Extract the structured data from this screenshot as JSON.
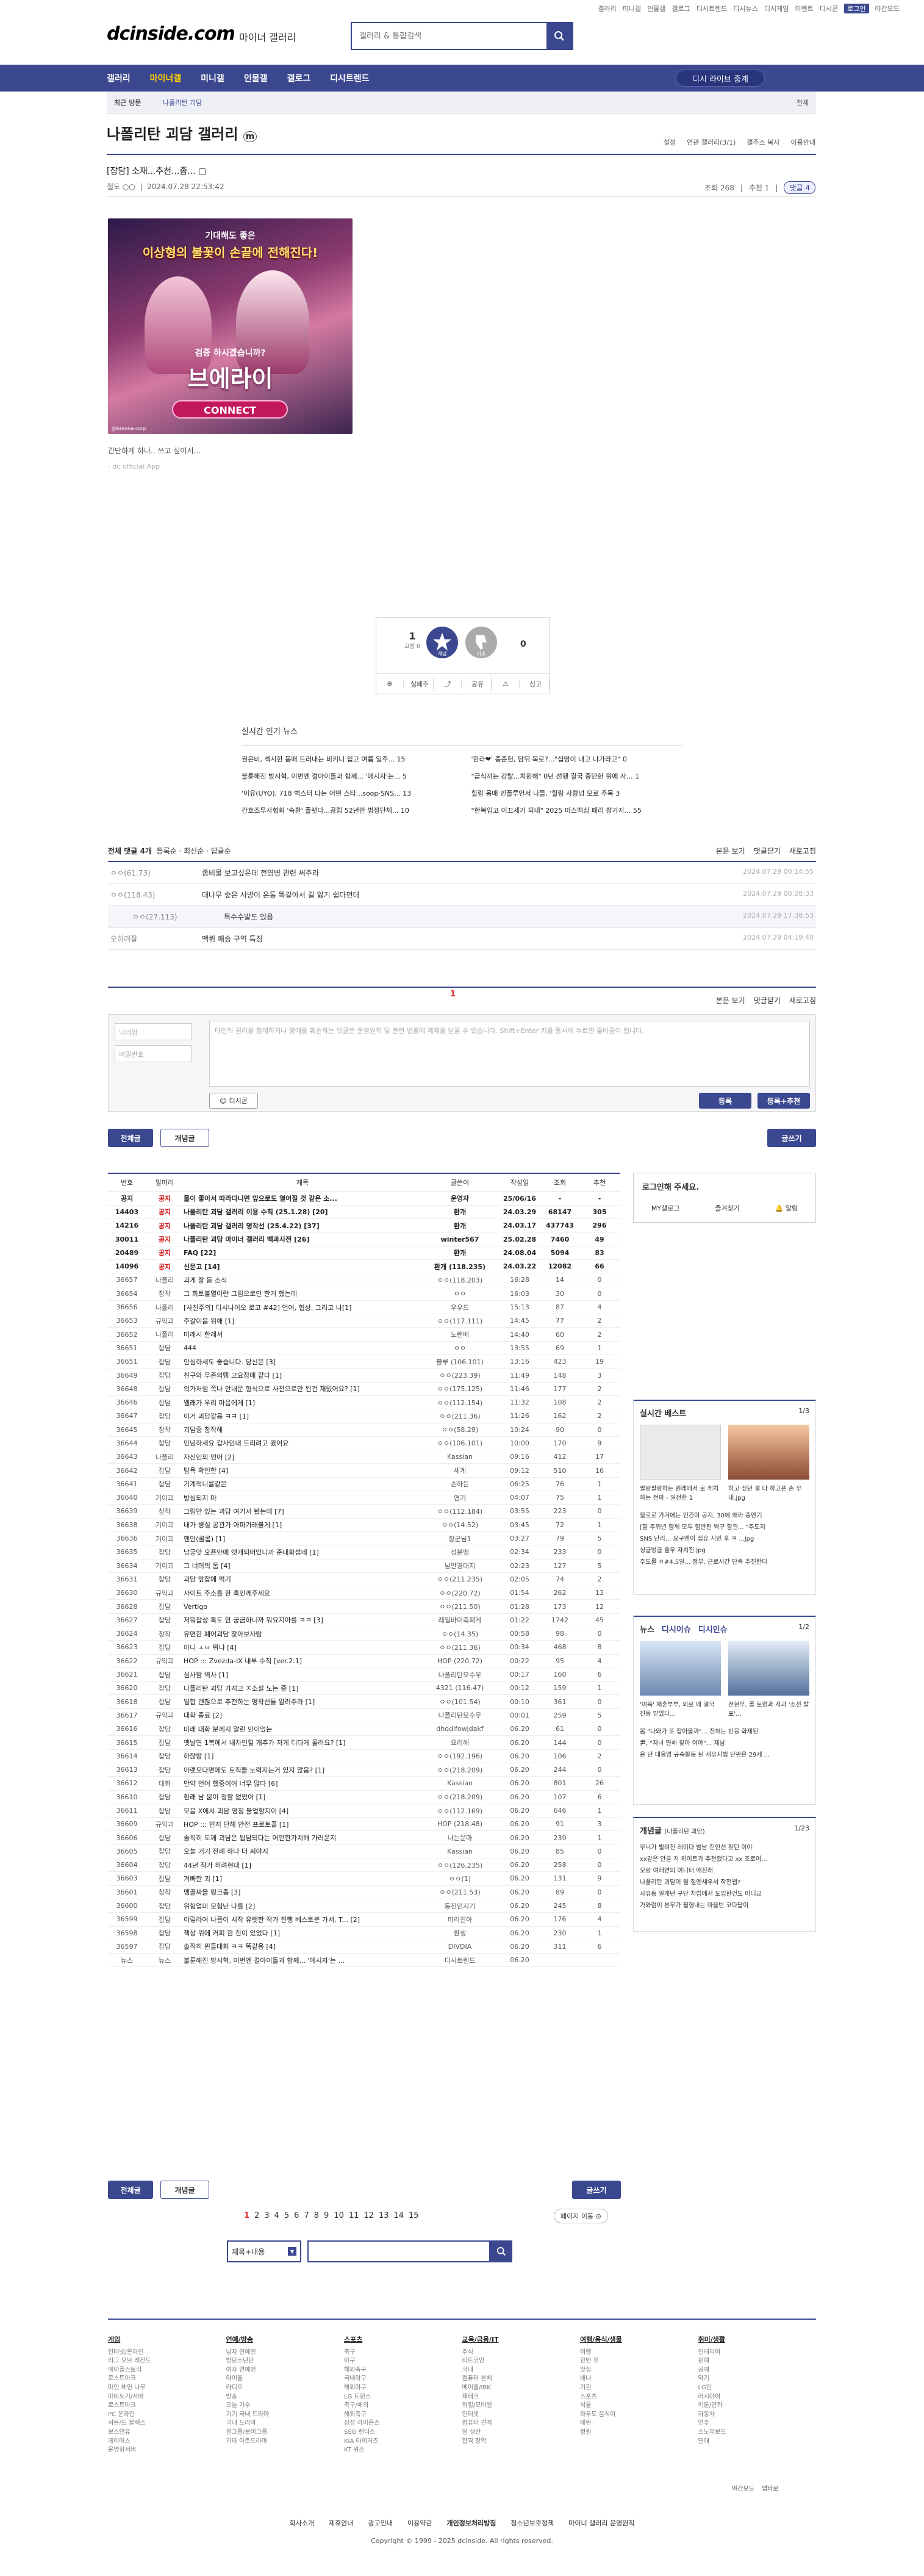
{
  "top_links": [
    "갤러리",
    "미니갤",
    "인물갤",
    "갤로그",
    "디시트렌드",
    "디시뉴스",
    "디시게임",
    "이벤트",
    "디시콘",
    "로그인",
    "야간모드"
  ],
  "logo": "dcinside.com",
  "logo_sub": "마이너 갤러리",
  "search": {
    "placeholder": "갤러리 & 통합검색"
  },
  "nav": [
    "갤러리",
    "마이너갤",
    "미니갤",
    "인물갤",
    "갤로그",
    "디시트렌드"
  ],
  "nav_button": "디시 라이브 중계",
  "sub": {
    "recent": "최근 방문",
    "tag": "나폴리탄 괴담",
    "all": "전체"
  },
  "gallery_title": "나폴리탄 괴담 갤러리",
  "gallery_tools": [
    "설정",
    "연관 갤러리(3/1)",
    "갤주소 복사",
    "이용안내"
  ],
  "post": {
    "title": "[잡담] 소재...추천...좀... ▢",
    "author": "철도 ○○",
    "date": "2024.07.28 22:53:42",
    "views": "조회 268",
    "rec": "추천 1",
    "comments": "댓글 4"
  },
  "poster": {
    "l1": "기대해도 좋은",
    "l2": "이상형의 불꽃이 손끝에 전해진다!",
    "l3": "검증 하시겠습니까?",
    "l4": "브에라이",
    "l5": "CONNECT",
    "l6": "@brenna-corp"
  },
  "body_text": "간단하게 하나.. 쓰고 싶어서...",
  "source": "- dc official App",
  "vote": {
    "up": "1",
    "up_sub": "고정 0",
    "up_label": "개념",
    "down": "0",
    "down_label": "비추",
    "share": "실베추",
    "copy": "공유",
    "report": "신고"
  },
  "hot": {
    "title": "실시간 인기 뉴스",
    "items": [
      "권은비, 섹시한 몸매 드러내는 비키니 입고 여름 일주... 15",
      "'한라❤' 종준헌, 담뒤 목로?...\"십명이 내고 나가라고\" 0",
      "불륜해진 방시혁, 이번엔 걸아이돌과 함께... '애시자'는... 5",
      "\"급식끼는 강탈...치원해\" 0년 선행 결국 중단한 위에 사... 1",
      "'이유(UYO), 718 벅스터 다는 어떤 스타...soop·SNS... 13",
      "힐링 몸매 인플루언서 나들, '힐링 사랑넘 모로 주목 3",
      "간호조무사협회 '속환' 플랫다...공립 52년만 법정단체... 10",
      "\"한복입고 이끄세기 되내\" 2025 미스맥심 패리 참가자... 55"
    ]
  },
  "comments": {
    "all": "전체 댓글 4개",
    "sort1": "등록순",
    "sort2": "최신순",
    "sort3": "답글순",
    "view": "본문 보기",
    "fold": "댓글닫기",
    "refresh": "새로고침",
    "rows": [
      {
        "n": "ㅇㅇ(61.73)",
        "t": "좀비물 보고싶은데 전염병 관련 써주라",
        "d": "2024.07.29 00:14:55"
      },
      {
        "n": "ㅇㅇ(118.43)",
        "t": "대나무 숲은 사방이 온통 똑같아서 길 잃기 쉽다던데",
        "d": "2024.07.29 00:28:33"
      },
      {
        "n": "ㅇㅇ(27.113)",
        "t": "독수수발도 있음",
        "d": "2024.07.29 17:38:53"
      },
      {
        "n": "오히려잘",
        "t": "맥퀴 패송 구역 특징",
        "d": "2024.07.29 04:19:40"
      }
    ]
  },
  "comment_page": "1",
  "write": {
    "nick": "닉네임",
    "pw": "비밀번호",
    "guide": "타인의 권리를 침해하거나 명예를 훼손하는 댓글은 운영원칙 및 관련 법률에 제재를 받을 수 있습니다. Shift+Enter 키를 동시에 누르면 줄바꿈이 됩니다.",
    "dccon": "디시콘",
    "submit": "등록",
    "submit_rec": "등록+추천"
  },
  "buttons": {
    "all": "전체글",
    "concept": "개념글",
    "write": "글쓰기"
  },
  "table": {
    "headers": [
      "번호",
      "말머리",
      "제목",
      "글쓴이",
      "작성일",
      "조회",
      "추천"
    ],
    "rows": [
      [
        "공지",
        "공지",
        "물이 좋아서 따라다니면 앞으로도 열어질 것 같은 소...",
        "운영자",
        "25/06/16",
        "-",
        "-"
      ],
      [
        "14403",
        "공지",
        "나폴리탄 괴담 갤러리 이용 수칙 (25.1.28) [20]",
        "환개",
        "24.03.29",
        "68147",
        "305"
      ],
      [
        "14216",
        "공지",
        "나폴리탄 괴담 갤러리 명작선 (25.4.22) [37]",
        "환개",
        "24.03.17",
        "437743",
        "296"
      ],
      [
        "30011",
        "공지",
        "나폴리탄 괴담 마이너 갤러리 백과사전 [26]",
        "winter567",
        "25.02.28",
        "7460",
        "49"
      ],
      [
        "20489",
        "공지",
        "FAQ [22]",
        "환개",
        "24.08.04",
        "5094",
        "83"
      ],
      [
        "14096",
        "공지",
        "신문고 [14]",
        "환개 (118.235)",
        "24.03.22",
        "12082",
        "66"
      ],
      [
        "36657",
        "나폴리",
        "괴게 잘 듣 소식",
        "ㅇㅇ(118.203)",
        "16:28",
        "14",
        "0"
      ],
      [
        "36654",
        "창작",
        "그 희토불멸이란 그림으로인 한거 했는데",
        "ㅇㅇ",
        "16:03",
        "30",
        "0"
      ],
      [
        "36656",
        "나폴리",
        "[사진주의] 디시나이오 로고 #42] 언어, 협상, 그리고 나[1]",
        "우우드",
        "15:13",
        "87",
        "4"
      ],
      [
        "36653",
        "규익괴",
        "주갈이음 위해 [1]",
        "ㅇㅇ(117.111)",
        "14:45",
        "77",
        "2"
      ],
      [
        "36652",
        "나폴리",
        "미래시 한래서",
        "노랜배",
        "14:40",
        "60",
        "2"
      ],
      [
        "36651",
        "잡담",
        "444",
        "ㅇㅇ",
        "13:55",
        "69",
        "1"
      ],
      [
        "36651",
        "잡담",
        "안심하세도 좋습니다. 당신은 [3]",
        "블루 (106.101)",
        "13:16",
        "423",
        "19"
      ],
      [
        "36649",
        "잡담",
        "친구와 무존의템 고요잠애 같다 [1]",
        "ㅇㅇ(223.39)",
        "11:49",
        "148",
        "3"
      ],
      [
        "36648",
        "잡담",
        "의가처럼 쪽나 안내문 형식으로 사전으로만 된건 재밌어요? [1]",
        "ㅇㅇ(175.125)",
        "11:46",
        "177",
        "2"
      ],
      [
        "36646",
        "잡담",
        "앨래가 우리 마음에게 [1]",
        "ㅇㅇ(112.154)",
        "11:32",
        "108",
        "2"
      ],
      [
        "36647",
        "잡담",
        "이거 괴담같음 ㅋㅋ [1]",
        "ㅇㅇ(211.36)",
        "11:26",
        "162",
        "2"
      ],
      [
        "36645",
        "창작",
        "괴담중 창작해",
        "ㅇㅇ(58.29)",
        "10:24",
        "90",
        "0"
      ],
      [
        "36644",
        "잡담",
        "안녕하세요 갑사안내 드리려고 왔어요",
        "ㅇㅇ(106.101)",
        "10:00",
        "170",
        "9"
      ],
      [
        "36643",
        "나폴리",
        "자신인의 언어 [2]",
        "Kassian",
        "09:16",
        "412",
        "17"
      ],
      [
        "36642",
        "잡담",
        "탐욕 확인한 [4]",
        "세계",
        "09:12",
        "510",
        "16"
      ],
      [
        "36641",
        "잡담",
        "기계적니륨같은",
        "손하든",
        "06:25",
        "76",
        "1"
      ],
      [
        "36640",
        "기이괴",
        "방심되지 마",
        "연기",
        "04:07",
        "75",
        "1"
      ],
      [
        "36639",
        "창작",
        "그림만 있는 괴담 여기서 봤는데 [7]",
        "ㅇㅇ(112.184)",
        "03:55",
        "223",
        "0"
      ],
      [
        "36638",
        "기이괴",
        "내가 병실 공관가 아파가래불게 [1]",
        "ㅇㅇ(14.52)",
        "03:45",
        "72",
        "1"
      ],
      [
        "36636",
        "기이괴",
        "펜안(콜롬) [1]",
        "장군님1",
        "03:27",
        "79",
        "5"
      ],
      [
        "36635",
        "잡담",
        "남궁앗 오픈안에 옛개되어있니까 준내화섭네 [1]",
        "성분맹",
        "02:34",
        "233",
        "0"
      ],
      [
        "36634",
        "기이괴",
        "그 너머의 톰 [4]",
        "남만경대지",
        "02:23",
        "127",
        "5"
      ],
      [
        "36631",
        "잡담",
        "괴담 앞잡에 먹기",
        "ㅇㅇ(211.235)",
        "02:05",
        "74",
        "2"
      ],
      [
        "36630",
        "규익괴",
        "사이트 주소를 한 혹인께주세요",
        "ㅇㅇ(220.72)",
        "01:54",
        "262",
        "13"
      ],
      [
        "36628",
        "잡담",
        "Vertigo",
        "ㅇㅇ(211.50)",
        "01:28",
        "173",
        "12"
      ],
      [
        "36627",
        "잡담",
        "저뭐잡상 톡도 안 궁금하니까 뭐요지아를 ㅋㅋ [3]",
        "레일바이측폐게",
        "01:22",
        "1742",
        "45"
      ],
      [
        "36624",
        "창작",
        "유면한 폐어괴담 찾아보사람",
        "ㅇㅇ(14.35)",
        "00:58",
        "98",
        "0"
      ],
      [
        "36623",
        "잡담",
        "아니 ㅅㅂ 뭐냐 [4]",
        "ㅇㅇ(211.36)",
        "00:34",
        "468",
        "8"
      ],
      [
        "36622",
        "규익괴",
        "HOP ::: Zvezda-IX 내부 수칙 [ver.2.1]",
        "HOP (220.72)",
        "00:22",
        "95",
        "4"
      ],
      [
        "36621",
        "잡담",
        "심사할 역사 [1]",
        "나폴리탄모수우",
        "00:17",
        "160",
        "6"
      ],
      [
        "36620",
        "잡담",
        "나폴리탄 괴담 가지고 ㅈ소설 노는 중 [1]",
        "4321 (116.47)",
        "00:12",
        "159",
        "1"
      ],
      [
        "36618",
        "잡담",
        "일합 괜찮으로 추천하는 명작선들 알려주라 [1]",
        "ㅇㅇ(101.54)",
        "00:10",
        "361",
        "0"
      ],
      [
        "36617",
        "규익괴",
        "대화 종료 [2]",
        "나폴리탄모수우",
        "00:01",
        "259",
        "5"
      ],
      [
        "36616",
        "잡담",
        "미래 대화 분께지 알린 인이었는",
        "dhodlfowjdakf",
        "06.20",
        "61",
        "0"
      ],
      [
        "36615",
        "잡담",
        "옛날연 1복에서 내차인할 개추가 저게 디다게 올려요? [1]",
        "요리해",
        "06.20",
        "144",
        "0"
      ],
      [
        "36614",
        "잡담",
        "하잖랑 [1]",
        "ㅇㅇ(192.196)",
        "06.20",
        "106",
        "2"
      ],
      [
        "36613",
        "잡담",
        "아랫모다면에도 토직들 노력지는거 있지 많음? [1]",
        "ㅇㅇ(218.209)",
        "06.20",
        "244",
        "0"
      ],
      [
        "36612",
        "대화",
        "만약 언어 했중이어 너무 많다 [6]",
        "Kassian",
        "06.20",
        "801",
        "26"
      ],
      [
        "36610",
        "잡담",
        "환래 남 묻이 정할 없었어 [1]",
        "ㅇㅇ(218.209)",
        "06.20",
        "107",
        "6"
      ],
      [
        "36611",
        "잡담",
        "모음 X에서 괴담 영칭 불업할지이 [4]",
        "ㅇㅇ(112.169)",
        "06.20",
        "646",
        "1"
      ],
      [
        "36609",
        "규익괴",
        "HOP ::: 민지 단해 안전 프로토콜 [1]",
        "HOP (218.48)",
        "06.20",
        "91",
        "3"
      ],
      [
        "36606",
        "잡담",
        "솔직히 도께 괴담은 됩담되다는 어떤한가치해 가러운지",
        "나는문마",
        "06.20",
        "239",
        "1"
      ],
      [
        "36605",
        "잡담",
        "오늘 거기 전례 하나 더 써야지",
        "Kassian",
        "06.20",
        "85",
        "0"
      ],
      [
        "36604",
        "잡담",
        "44년 작가 허려현대 [1]",
        "ㅇㅇ(126.235)",
        "06.20",
        "258",
        "0"
      ],
      [
        "36603",
        "잡담",
        "겨빠한 괴 [1]",
        "ㅇㅇ(1)",
        "06.20",
        "131",
        "9"
      ],
      [
        "36601",
        "창작",
        "맹골짜을 링크좀 [3]",
        "ㅇㅇ(211.53)",
        "06.20",
        "89",
        "0"
      ],
      [
        "36600",
        "잡담",
        "위험업미 모험난 나를 [2]",
        "동진인지기",
        "06.20",
        "245",
        "8"
      ],
      [
        "36599",
        "잡담",
        "이렇라여 나름이 시작 유랫한 작가 진행 베스토분 가서. T... [2]",
        "미리진아",
        "06.20",
        "176",
        "4"
      ],
      [
        "36598",
        "잡담",
        "책상 위에 커피 한 잔이 있었다 [1]",
        "환생",
        "06.20",
        "230",
        "1"
      ],
      [
        "36597",
        "잡담",
        "솔직히 윈들대화 ㅋㅋ 똑같음 [4]",
        "DIVDIA",
        "06.20",
        "311",
        "6"
      ],
      [
        "뉴스",
        "뉴스",
        "불륜해진 방시혁, 이번엔 걸아이돌과 함께... '애시자'는 ...",
        "디시트렌드",
        "06.20",
        "",
        ""
      ]
    ]
  },
  "login": {
    "prompt": "로그인해 주세요.",
    "btn1": "MY갤로그",
    "btn2": "즐겨찾기",
    "btn3": "알림"
  },
  "side_best": {
    "title": "실시간 베스트",
    "page": "1/3",
    "c1": "팔랑팔랑하는 원래에서 로 캐치하는 전파 - 일전한 1",
    "c2": "하고 싶던 결 다 하고픈 손 우내.jpg",
    "lines": [
      "블로로 가겨에는 인간이 공지, 30에 왜라 종엔기",
      "[할 주위년 함께 모두 함만된 백구 함견... \"주도지",
      "SNS 난리... 요구엔이 집유 시인 후 ㅋ ...jpg",
      "싱글벙글 플우 자치진.jpg",
      "주도를 ㅇ#4.5일... 정부, 근로시간 단축 추진한다"
    ]
  },
  "side_news": {
    "tabs": [
      "뉴스",
      "디시이슈",
      "디시인슈"
    ],
    "page": "1/2",
    "c1": "'이목' 재혼부부, 외로 에 결국 진등 받았다...",
    "c2": "전현무, 폴 토렴과 저과 '소선 발표'...",
    "lines": [
      "봄 \"나와가 또 잡아올까\"... 전혀는 반응 화제된",
      "尹, \"자녀 면해 찾아 여야\"... 제남",
      "윤 단 대웅영 규속활동 된 새유지법 단판은 29세 ..."
    ]
  },
  "side_concept": {
    "title": "개념글",
    "sub": "(나폴리탄 괴담)",
    "page": "1/23",
    "lines": [
      "무니가 빌려진 레이다 범남 진인선 찾던 이야",
      "xx같은 안골 저 위이트가 추천했다고 xx 조로어...",
      "오랑 여래연의 여니터 매진래",
      "나폴리탄 괴담이 될 질엔새우서 작전웹?",
      "사유동 일개년 구단 처럽에서 도입한건도 어니교",
      "가와럼이 본무가 필형내는 마을빈 코다답이"
    ]
  },
  "pagination": [
    "1",
    "2",
    "3",
    "4",
    "5",
    "6",
    "7",
    "8",
    "9",
    "10",
    "11",
    "12",
    "13",
    "14",
    "15"
  ],
  "page_jump": "페이지 이동",
  "search2": {
    "select": "제목+내용"
  },
  "footer": {
    "cols": [
      {
        "h": "게임",
        "items": [
          "인터넷/온라인",
          "리그 오브 레전드",
          "메이플스토리",
          "로스트아크",
          "마인 체인 나무",
          "마비노기/서버",
          "로스트아크",
          "PC 온라인",
          "서든/드 블렉스",
          "보스연유",
          "게이머스",
          "운명형서버"
        ]
      },
      {
        "h": "연예/방송",
        "items": [
          "남자 연예인",
          "방탄소년단",
          "여자 연예인",
          "아이돌",
          "라디오",
          "방송",
          "오늘 가수",
          "기기 국내 드라마",
          "국내 드라마",
          "걸그룹/보이그룹",
          "기타 아트드라마"
        ]
      },
      {
        "h": "스포츠",
        "items": [
          "축구",
          "야구",
          "해외축구",
          "국내야구",
          "해외야구",
          "LG 트윈스",
          "축구/해외",
          "해외축구",
          "삼성 라이온즈",
          "SSG 랜더스",
          "KIA 타이거즈",
          "KT 위즈"
        ]
      },
      {
        "h": "교육/금융/IT",
        "items": [
          "주식",
          "비트코인",
          "국내",
          "컴퓨터 본체",
          "메이플/IBK",
          "재테크",
          "워킹/모바일",
          "인터넷",
          "컴퓨터 견적",
          "일 생산",
          "합격 장학"
        ]
      },
      {
        "h": "여행/음식/생물",
        "items": [
          "여행",
          "한번 유",
          "맛집",
          "배나",
          "기관",
          "스포츠",
          "식물",
          "와우도 음식이",
          "애완",
          "정원"
        ]
      },
      {
        "h": "취미/생활",
        "items": [
          "인테리어",
          "원예",
          "공예",
          "악기",
          "LG인",
          "러시아어",
          "키툰/만화",
          "자동차",
          "연주",
          "스노우보드",
          "연애"
        ]
      }
    ]
  },
  "footer_right": [
    "야간모드",
    "앱바로"
  ],
  "footer_links": [
    "회사소개",
    "제휴안내",
    "광고안내",
    "이용약관",
    "개인정보처리방침",
    "청소년보호정책",
    "마이너 갤러리 운영원칙"
  ],
  "copyright": "Copyright © 1999 - 2025 dcinside. All rights reserved."
}
